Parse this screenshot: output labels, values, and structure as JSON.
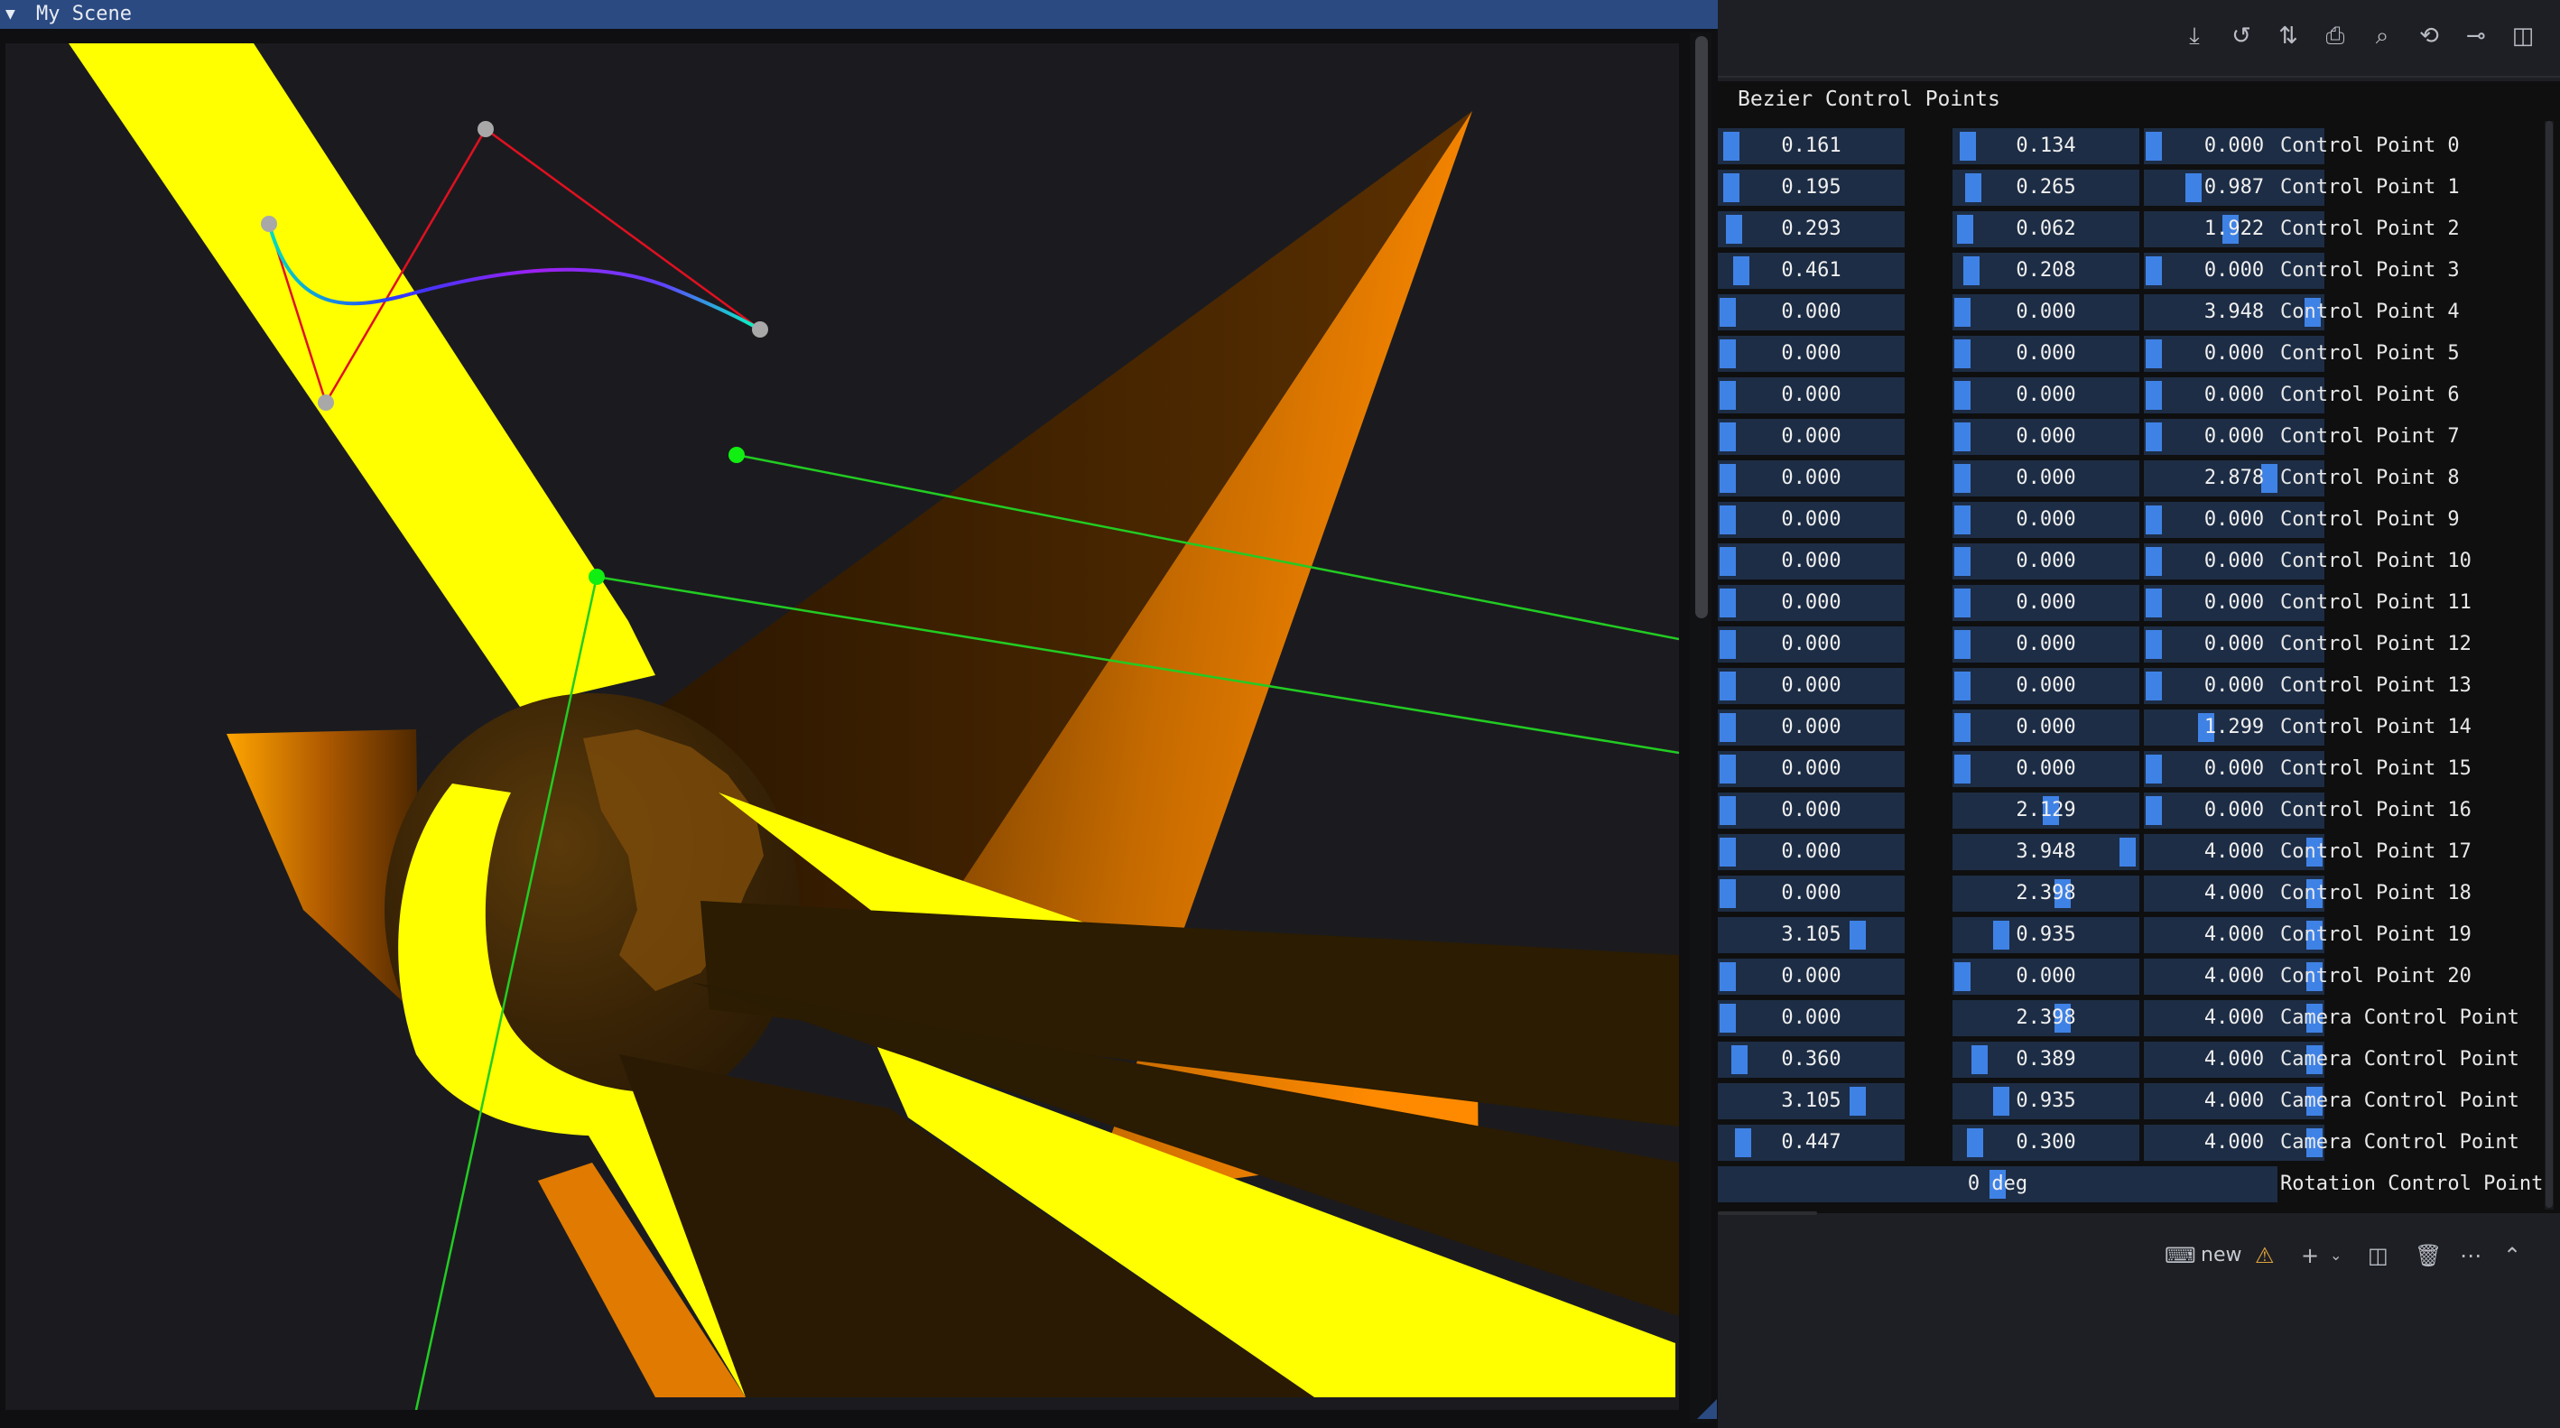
{
  "scene": {
    "title": "My Scene",
    "collapse_icon": "triangle-down"
  },
  "toolbar": {
    "icons": [
      "download-icon",
      "history-icon",
      "compare-icon",
      "print-icon",
      "find-icon",
      "rotate-icon",
      "commit-icon",
      "split-icon"
    ]
  },
  "bezier": {
    "title": "Bezier Control Points",
    "rows": [
      {
        "label": "Control Point 0",
        "v": [
          "0.161",
          "0.134",
          "0.000"
        ],
        "f": [
          0.02,
          0.034,
          0.0
        ]
      },
      {
        "label": "Control Point 1",
        "v": [
          "0.195",
          "0.265",
          "0.987"
        ],
        "f": [
          0.024,
          0.066,
          0.247
        ]
      },
      {
        "label": "Control Point 2",
        "v": [
          "0.293",
          "0.062",
          "1.922"
        ],
        "f": [
          0.04,
          0.015,
          0.48
        ]
      },
      {
        "label": "Control Point 3",
        "v": [
          "0.461",
          "0.208",
          "0.000"
        ],
        "f": [
          0.08,
          0.052,
          0.0
        ]
      },
      {
        "label": "Control Point 4",
        "v": [
          "0.000",
          "0.000",
          "3.948"
        ],
        "f": [
          0.0,
          0.0,
          0.987
        ]
      },
      {
        "label": "Control Point 5",
        "v": [
          "0.000",
          "0.000",
          "0.000"
        ],
        "f": [
          0.0,
          0.0,
          0.0
        ]
      },
      {
        "label": "Control Point 6",
        "v": [
          "0.000",
          "0.000",
          "0.000"
        ],
        "f": [
          0.0,
          0.0,
          0.0
        ]
      },
      {
        "label": "Control Point 7",
        "v": [
          "0.000",
          "0.000",
          "0.000"
        ],
        "f": [
          0.0,
          0.0,
          0.0
        ]
      },
      {
        "label": "Control Point 8",
        "v": [
          "0.000",
          "0.000",
          "2.878"
        ],
        "f": [
          0.0,
          0.0,
          0.72
        ]
      },
      {
        "label": "Control Point 9",
        "v": [
          "0.000",
          "0.000",
          "0.000"
        ],
        "f": [
          0.0,
          0.0,
          0.0
        ]
      },
      {
        "label": "Control Point 10",
        "v": [
          "0.000",
          "0.000",
          "0.000"
        ],
        "f": [
          0.0,
          0.0,
          0.0
        ]
      },
      {
        "label": "Control Point 11",
        "v": [
          "0.000",
          "0.000",
          "0.000"
        ],
        "f": [
          0.0,
          0.0,
          0.0
        ]
      },
      {
        "label": "Control Point 12",
        "v": [
          "0.000",
          "0.000",
          "0.000"
        ],
        "f": [
          0.0,
          0.0,
          0.0
        ]
      },
      {
        "label": "Control Point 13",
        "v": [
          "0.000",
          "0.000",
          "0.000"
        ],
        "f": [
          0.0,
          0.0,
          0.0
        ]
      },
      {
        "label": "Control Point 14",
        "v": [
          "0.000",
          "0.000",
          "1.299"
        ],
        "f": [
          0.0,
          0.0,
          0.325
        ]
      },
      {
        "label": "Control Point 15",
        "v": [
          "0.000",
          "0.000",
          "0.000"
        ],
        "f": [
          0.0,
          0.0,
          0.0
        ]
      },
      {
        "label": "Control Point 16",
        "v": [
          "0.000",
          "2.129",
          "0.000"
        ],
        "f": [
          0.0,
          0.532,
          0.0
        ]
      },
      {
        "label": "Control Point 17",
        "v": [
          "0.000",
          "3.948",
          "4.000"
        ],
        "f": [
          0.0,
          0.987,
          1.0
        ]
      },
      {
        "label": "Control Point 18",
        "v": [
          "0.000",
          "2.398",
          "4.000"
        ],
        "f": [
          0.0,
          0.6,
          1.0
        ]
      },
      {
        "label": "Control Point 19",
        "v": [
          "3.105",
          "0.935",
          "4.000"
        ],
        "f": [
          0.776,
          0.234,
          1.0
        ]
      },
      {
        "label": "Control Point 20",
        "v": [
          "0.000",
          "0.000",
          "4.000"
        ],
        "f": [
          0.0,
          0.0,
          1.0
        ]
      },
      {
        "label": "Camera Control Point",
        "v": [
          "0.000",
          "2.398",
          "4.000"
        ],
        "f": [
          0.0,
          0.6,
          1.0
        ]
      },
      {
        "label": "Camera Control Point",
        "v": [
          "0.360",
          "0.389",
          "4.000"
        ],
        "f": [
          0.07,
          0.1,
          1.0
        ]
      },
      {
        "label": "Camera Control Point",
        "v": [
          "3.105",
          "0.935",
          "4.000"
        ],
        "f": [
          0.776,
          0.234,
          1.0
        ]
      },
      {
        "label": "Camera Control Point",
        "v": [
          "0.447",
          "0.300",
          "4.000"
        ],
        "f": [
          0.09,
          0.075,
          1.0
        ]
      }
    ],
    "rotation": {
      "label": "Rotation Control Point",
      "value": "0 deg",
      "f": 0.5
    }
  },
  "terminal": {
    "label": "new",
    "icons": [
      "terminal-icon",
      "warning-icon",
      "plus-icon",
      "chevron-down-icon",
      "split-icon",
      "trash-icon",
      "more-icon",
      "chevron-up-icon"
    ]
  },
  "colors": {
    "accent": "#3f82e6",
    "cell_bg": "#1d2d45",
    "title_bar": "#2b4a82",
    "yellow": "#ffff00",
    "orange": "#ff8c00",
    "green_line": "#22cc22"
  }
}
